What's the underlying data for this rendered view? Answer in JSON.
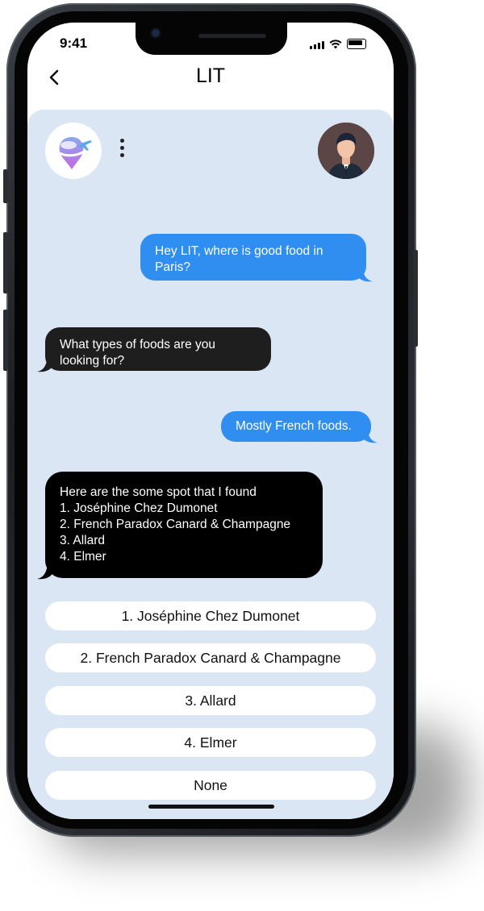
{
  "status_bar": {
    "time": "9:41"
  },
  "header": {
    "title": "LIT"
  },
  "messages": [
    {
      "sender": "user",
      "text": "Hey LIT, where is good food in Paris?"
    },
    {
      "sender": "bot",
      "text": "What types of foods are you looking for?"
    },
    {
      "sender": "user",
      "text": "Mostly French foods."
    },
    {
      "sender": "bot",
      "lines": [
        "Here are the some spot that I found",
        "1. Joséphine Chez Dumonet",
        "2. French Paradox Canard & Champagne",
        "3. Allard",
        "4. Elmer"
      ]
    }
  ],
  "options": [
    "1. Joséphine Chez Dumonet",
    "2. French Paradox Canard & Champagne",
    "3. Allard",
    "4. Elmer",
    "None"
  ],
  "icons": {
    "back": "chevron-left-icon",
    "menu": "more-vertical-icon",
    "bot_avatar": "travel-pin-airplane-logo",
    "user_avatar": "user-avatar-man"
  },
  "colors": {
    "chat_background": "#dbe6f5",
    "user_bubble": "#2f8ef0",
    "bot_bubble": "#1e1e1e",
    "option_background": "#ffffff"
  }
}
